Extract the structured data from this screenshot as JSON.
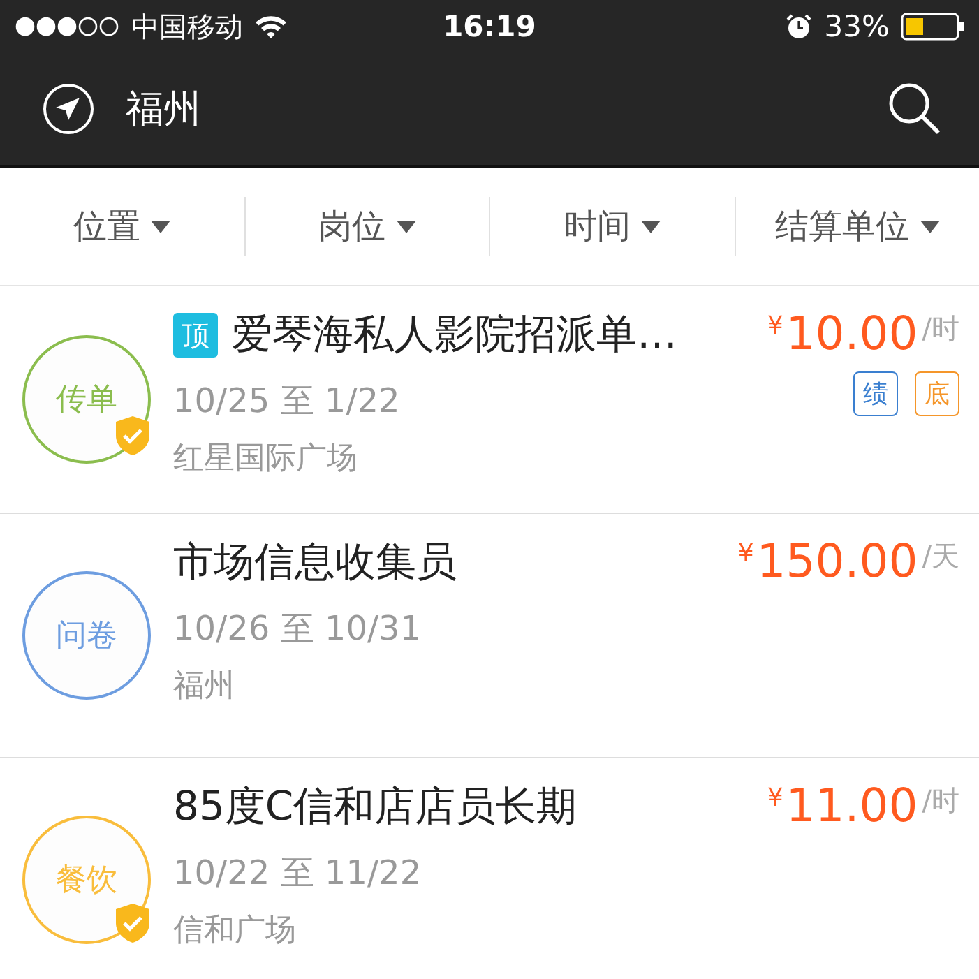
{
  "status_bar": {
    "carrier": "中国移动",
    "time": "16:19",
    "battery": "33%"
  },
  "nav": {
    "city": "福州"
  },
  "filters": [
    {
      "label": "位置"
    },
    {
      "label": "岗位"
    },
    {
      "label": "时间"
    },
    {
      "label": "结算单位"
    }
  ],
  "jobs": [
    {
      "category": "传单",
      "color": "#8bbd4e",
      "verified": true,
      "pinned_badge": "顶",
      "title": "爱琴海私人影院招派单…",
      "dates": "10/25 至 1/22",
      "location": "红星国际广场",
      "currency": "¥",
      "amount": "10.00",
      "unit": "/时",
      "tags": [
        {
          "label": "绩",
          "color": "#3a7fd0"
        },
        {
          "label": "底",
          "color": "#f5962a"
        }
      ]
    },
    {
      "category": "问卷",
      "color": "#6d9de0",
      "verified": false,
      "title": "市场信息收集员",
      "dates": "10/26 至 10/31",
      "location": "福州",
      "currency": "¥",
      "amount": "150.00",
      "unit": "/天"
    },
    {
      "category": "餐饮",
      "color": "#f9bd3c",
      "verified": true,
      "title": "85度C信和店店员长期",
      "dates": "10/22 至 11/22",
      "location": "信和广场",
      "currency": "¥",
      "amount": "11.00",
      "unit": "/时"
    }
  ]
}
